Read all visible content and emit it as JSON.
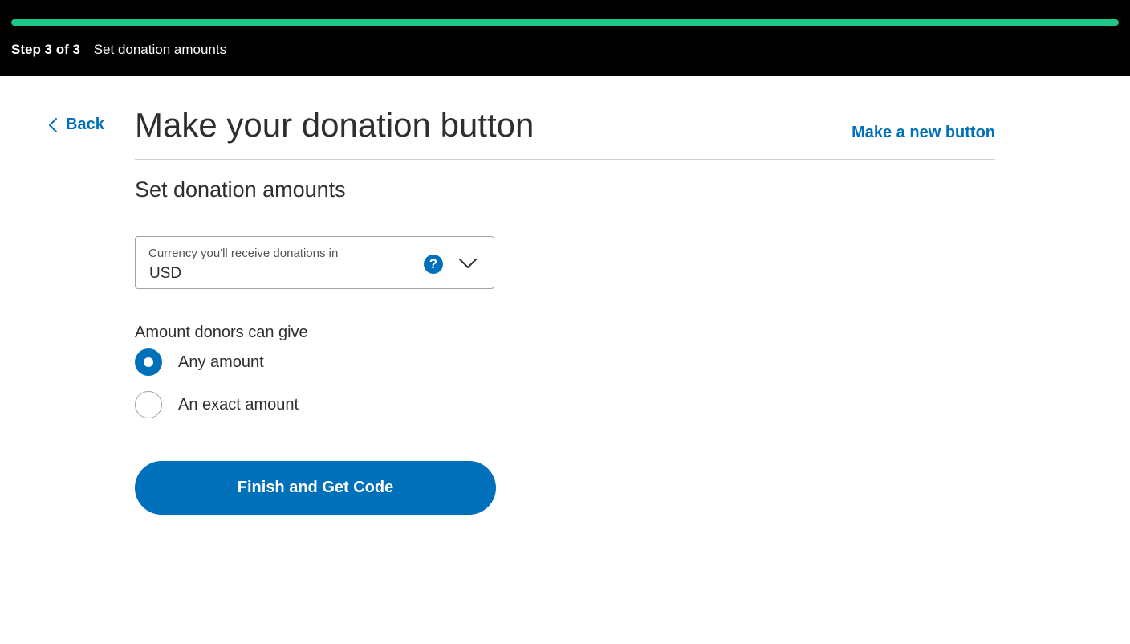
{
  "header": {
    "progress_percent": 100,
    "step_count": "Step 3 of 3",
    "step_title": "Set donation amounts",
    "accent_color": "#1ec688"
  },
  "nav": {
    "back_label": "Back",
    "back_icon": "chevron-left-icon"
  },
  "page": {
    "title": "Make your donation button",
    "new_button_label": "Make a new button",
    "section_title": "Set donation amounts"
  },
  "currency": {
    "label": "Currency you'll receive donations in",
    "value": "USD",
    "help_icon": "question-circle-icon",
    "help_glyph": "?",
    "dropdown_icon": "chevron-down-icon"
  },
  "amount": {
    "label": "Amount donors can give",
    "options": [
      {
        "label": "Any amount",
        "selected": true
      },
      {
        "label": "An exact amount",
        "selected": false
      }
    ]
  },
  "actions": {
    "finish_label": "Finish and Get Code",
    "primary_color": "#0070ba"
  }
}
